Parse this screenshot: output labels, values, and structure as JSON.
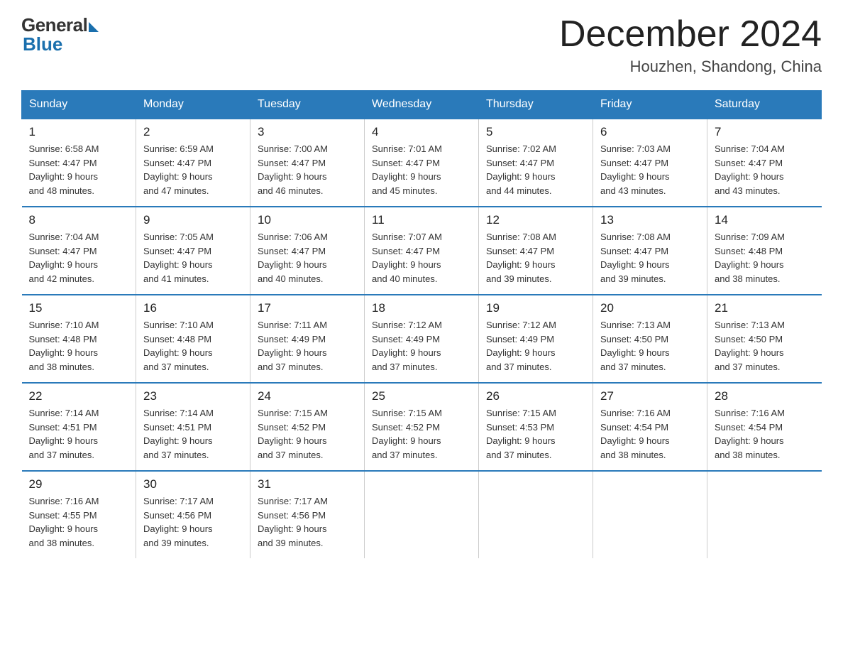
{
  "header": {
    "logo_general": "General",
    "logo_blue": "Blue",
    "month_title": "December 2024",
    "location": "Houzhen, Shandong, China"
  },
  "weekdays": [
    "Sunday",
    "Monday",
    "Tuesday",
    "Wednesday",
    "Thursday",
    "Friday",
    "Saturday"
  ],
  "weeks": [
    [
      {
        "day": "1",
        "sunrise": "6:58 AM",
        "sunset": "4:47 PM",
        "daylight": "9 hours and 48 minutes."
      },
      {
        "day": "2",
        "sunrise": "6:59 AM",
        "sunset": "4:47 PM",
        "daylight": "9 hours and 47 minutes."
      },
      {
        "day": "3",
        "sunrise": "7:00 AM",
        "sunset": "4:47 PM",
        "daylight": "9 hours and 46 minutes."
      },
      {
        "day": "4",
        "sunrise": "7:01 AM",
        "sunset": "4:47 PM",
        "daylight": "9 hours and 45 minutes."
      },
      {
        "day": "5",
        "sunrise": "7:02 AM",
        "sunset": "4:47 PM",
        "daylight": "9 hours and 44 minutes."
      },
      {
        "day": "6",
        "sunrise": "7:03 AM",
        "sunset": "4:47 PM",
        "daylight": "9 hours and 43 minutes."
      },
      {
        "day": "7",
        "sunrise": "7:04 AM",
        "sunset": "4:47 PM",
        "daylight": "9 hours and 43 minutes."
      }
    ],
    [
      {
        "day": "8",
        "sunrise": "7:04 AM",
        "sunset": "4:47 PM",
        "daylight": "9 hours and 42 minutes."
      },
      {
        "day": "9",
        "sunrise": "7:05 AM",
        "sunset": "4:47 PM",
        "daylight": "9 hours and 41 minutes."
      },
      {
        "day": "10",
        "sunrise": "7:06 AM",
        "sunset": "4:47 PM",
        "daylight": "9 hours and 40 minutes."
      },
      {
        "day": "11",
        "sunrise": "7:07 AM",
        "sunset": "4:47 PM",
        "daylight": "9 hours and 40 minutes."
      },
      {
        "day": "12",
        "sunrise": "7:08 AM",
        "sunset": "4:47 PM",
        "daylight": "9 hours and 39 minutes."
      },
      {
        "day": "13",
        "sunrise": "7:08 AM",
        "sunset": "4:47 PM",
        "daylight": "9 hours and 39 minutes."
      },
      {
        "day": "14",
        "sunrise": "7:09 AM",
        "sunset": "4:48 PM",
        "daylight": "9 hours and 38 minutes."
      }
    ],
    [
      {
        "day": "15",
        "sunrise": "7:10 AM",
        "sunset": "4:48 PM",
        "daylight": "9 hours and 38 minutes."
      },
      {
        "day": "16",
        "sunrise": "7:10 AM",
        "sunset": "4:48 PM",
        "daylight": "9 hours and 37 minutes."
      },
      {
        "day": "17",
        "sunrise": "7:11 AM",
        "sunset": "4:49 PM",
        "daylight": "9 hours and 37 minutes."
      },
      {
        "day": "18",
        "sunrise": "7:12 AM",
        "sunset": "4:49 PM",
        "daylight": "9 hours and 37 minutes."
      },
      {
        "day": "19",
        "sunrise": "7:12 AM",
        "sunset": "4:49 PM",
        "daylight": "9 hours and 37 minutes."
      },
      {
        "day": "20",
        "sunrise": "7:13 AM",
        "sunset": "4:50 PM",
        "daylight": "9 hours and 37 minutes."
      },
      {
        "day": "21",
        "sunrise": "7:13 AM",
        "sunset": "4:50 PM",
        "daylight": "9 hours and 37 minutes."
      }
    ],
    [
      {
        "day": "22",
        "sunrise": "7:14 AM",
        "sunset": "4:51 PM",
        "daylight": "9 hours and 37 minutes."
      },
      {
        "day": "23",
        "sunrise": "7:14 AM",
        "sunset": "4:51 PM",
        "daylight": "9 hours and 37 minutes."
      },
      {
        "day": "24",
        "sunrise": "7:15 AM",
        "sunset": "4:52 PM",
        "daylight": "9 hours and 37 minutes."
      },
      {
        "day": "25",
        "sunrise": "7:15 AM",
        "sunset": "4:52 PM",
        "daylight": "9 hours and 37 minutes."
      },
      {
        "day": "26",
        "sunrise": "7:15 AM",
        "sunset": "4:53 PM",
        "daylight": "9 hours and 37 minutes."
      },
      {
        "day": "27",
        "sunrise": "7:16 AM",
        "sunset": "4:54 PM",
        "daylight": "9 hours and 38 minutes."
      },
      {
        "day": "28",
        "sunrise": "7:16 AM",
        "sunset": "4:54 PM",
        "daylight": "9 hours and 38 minutes."
      }
    ],
    [
      {
        "day": "29",
        "sunrise": "7:16 AM",
        "sunset": "4:55 PM",
        "daylight": "9 hours and 38 minutes."
      },
      {
        "day": "30",
        "sunrise": "7:17 AM",
        "sunset": "4:56 PM",
        "daylight": "9 hours and 39 minutes."
      },
      {
        "day": "31",
        "sunrise": "7:17 AM",
        "sunset": "4:56 PM",
        "daylight": "9 hours and 39 minutes."
      },
      null,
      null,
      null,
      null
    ]
  ],
  "labels": {
    "sunrise": "Sunrise:",
    "sunset": "Sunset:",
    "daylight": "Daylight:"
  }
}
